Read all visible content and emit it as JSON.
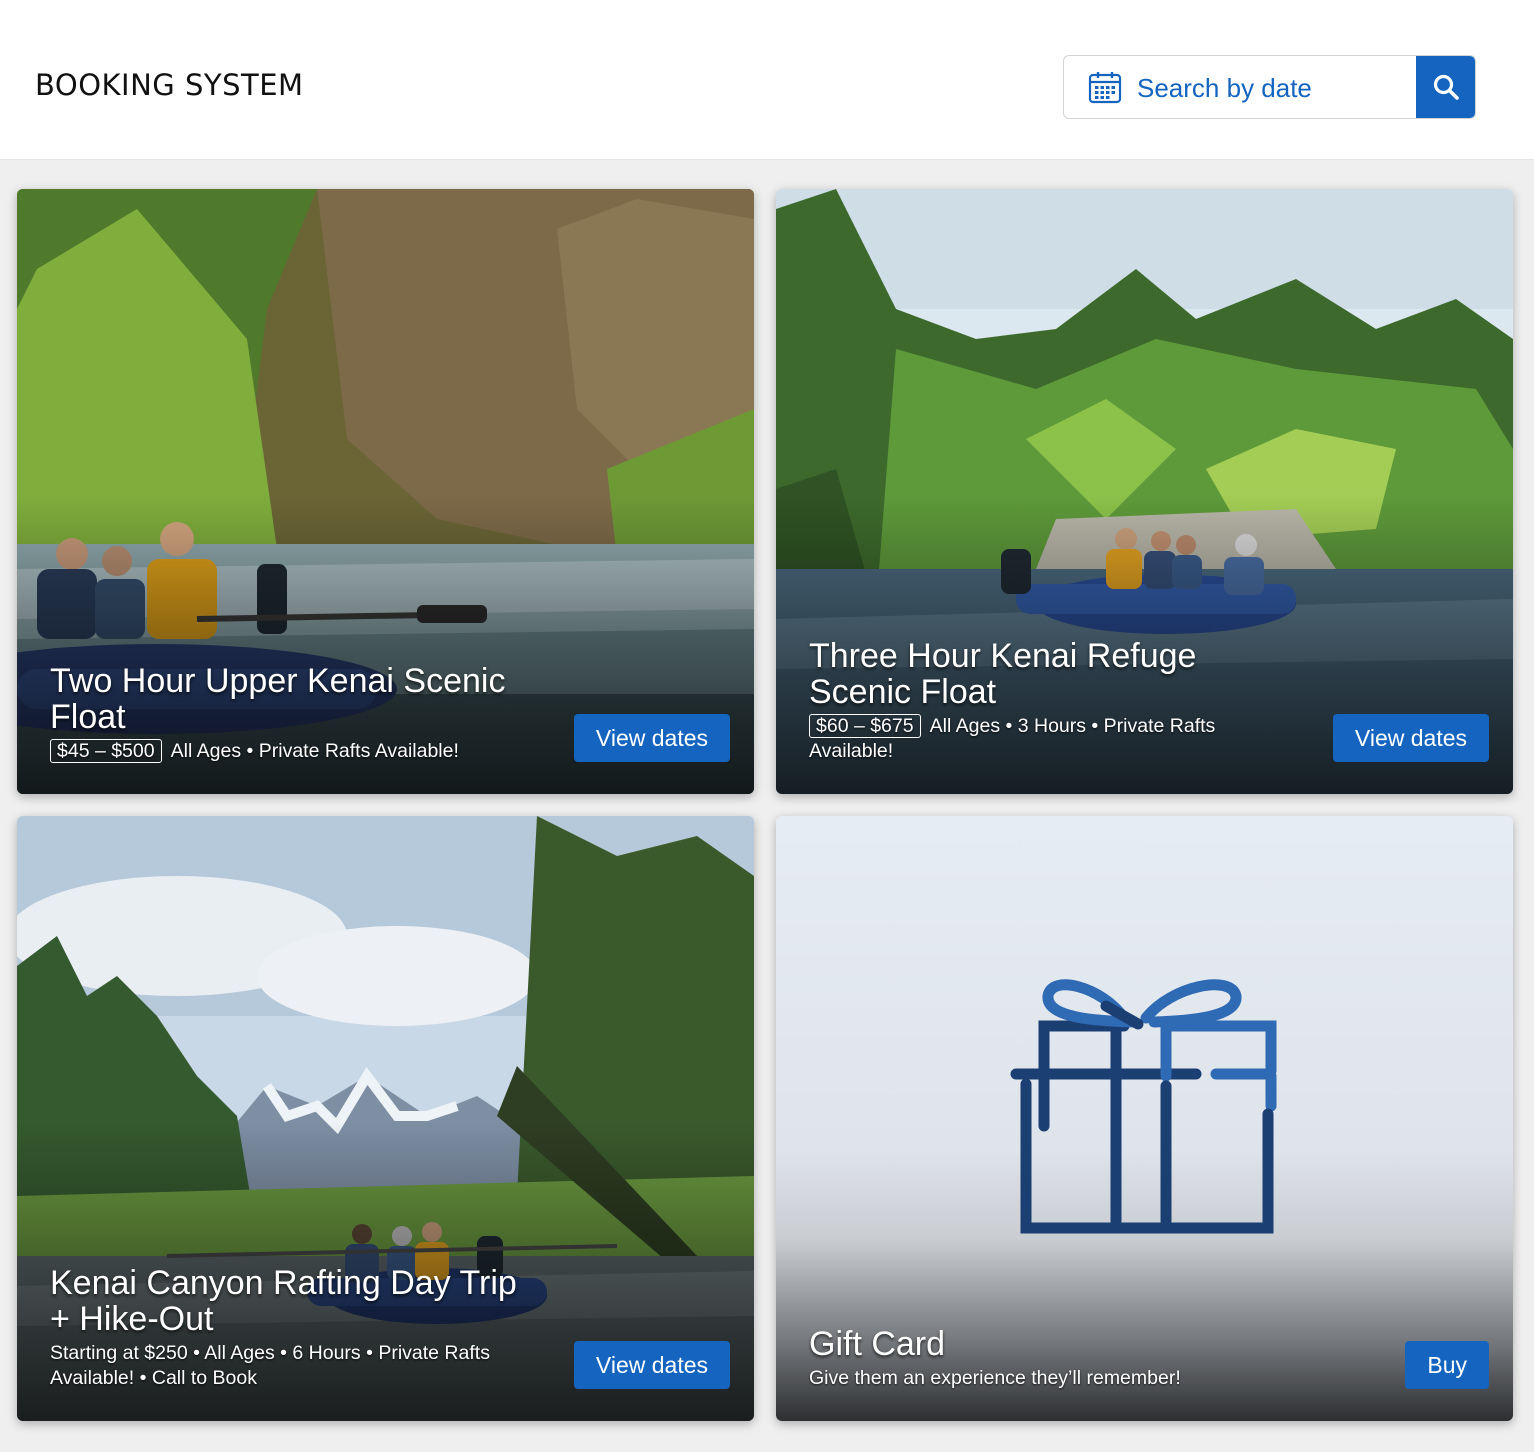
{
  "header": {
    "brand": "BOOKING SYSTEM",
    "search": {
      "label": "Search by date",
      "calendar_icon": "calendar-icon",
      "button_icon": "search-icon"
    }
  },
  "colors": {
    "accent": "#1565c0",
    "gift_dark": "#1b3f73",
    "gift_light": "#2f6ab4"
  },
  "cards": [
    {
      "title": "Two Hour Upper Kenai Scenic Float",
      "price": "$45 – $500",
      "details": "All Ages • Private Rafts Available!",
      "button": "View dates"
    },
    {
      "title": "Three Hour Kenai Refuge Scenic Float",
      "price": "$60 – $675",
      "details": "All Ages • 3 Hours • Private Rafts Available!",
      "button": "View dates"
    },
    {
      "title": "Kenai Canyon Rafting Day Trip + Hike-Out",
      "details": "Starting at $250 • All Ages • 6 Hours • Private Rafts Available! • Call to Book",
      "button": "View dates"
    },
    {
      "title": "Gift Card",
      "details": "Give them an experience they’ll remember!",
      "button": "Buy",
      "icon": "gift-icon"
    }
  ]
}
